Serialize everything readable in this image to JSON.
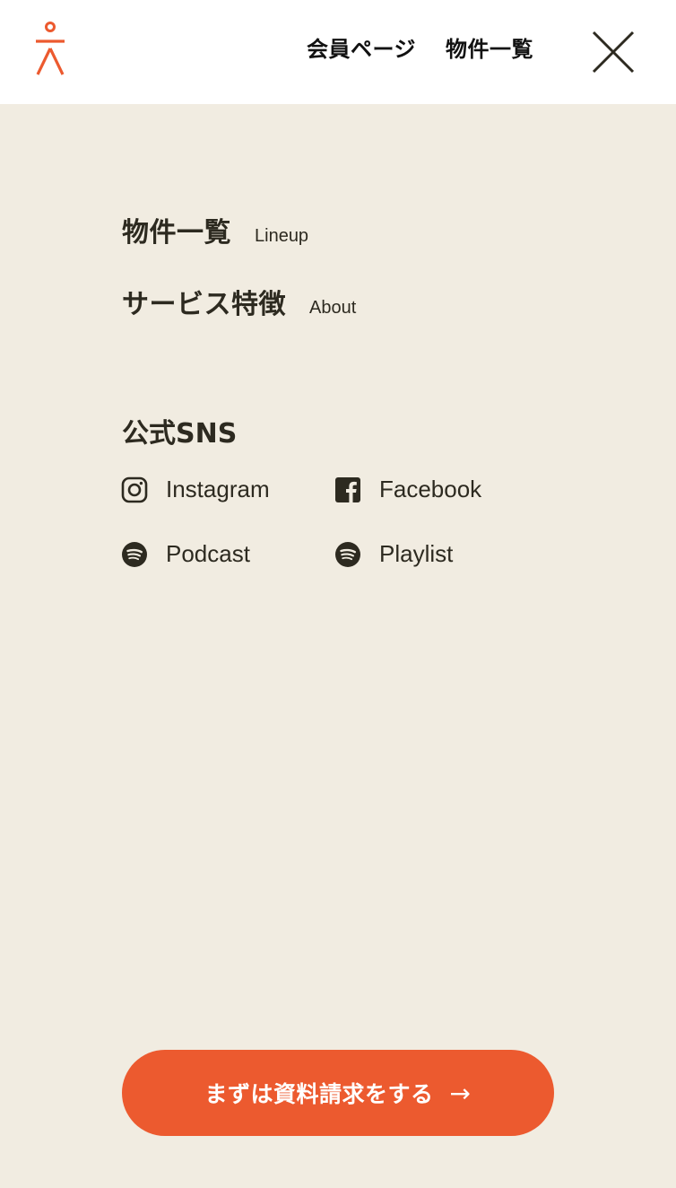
{
  "header": {
    "logo_icon": "person-logo-icon",
    "member_page": "会員ページ",
    "lineup": "物件一覧",
    "close_icon": "close-icon"
  },
  "menu": {
    "items": [
      {
        "ja": "物件一覧",
        "en": "Lineup"
      },
      {
        "ja": "サービス特徴",
        "en": "About"
      }
    ]
  },
  "sns": {
    "title": "公式SNS",
    "links": [
      {
        "label": "Instagram",
        "icon": "instagram-icon"
      },
      {
        "label": "Facebook",
        "icon": "facebook-icon"
      },
      {
        "label": "Podcast",
        "icon": "spotify-icon"
      },
      {
        "label": "Playlist",
        "icon": "spotify-icon"
      }
    ]
  },
  "cta": {
    "label": "まずは資料請求をする",
    "arrow": "→"
  },
  "colors": {
    "background": "#f1ece1",
    "header": "#ffffff",
    "accent": "#ec5a2f",
    "text": "#2d2a20"
  }
}
